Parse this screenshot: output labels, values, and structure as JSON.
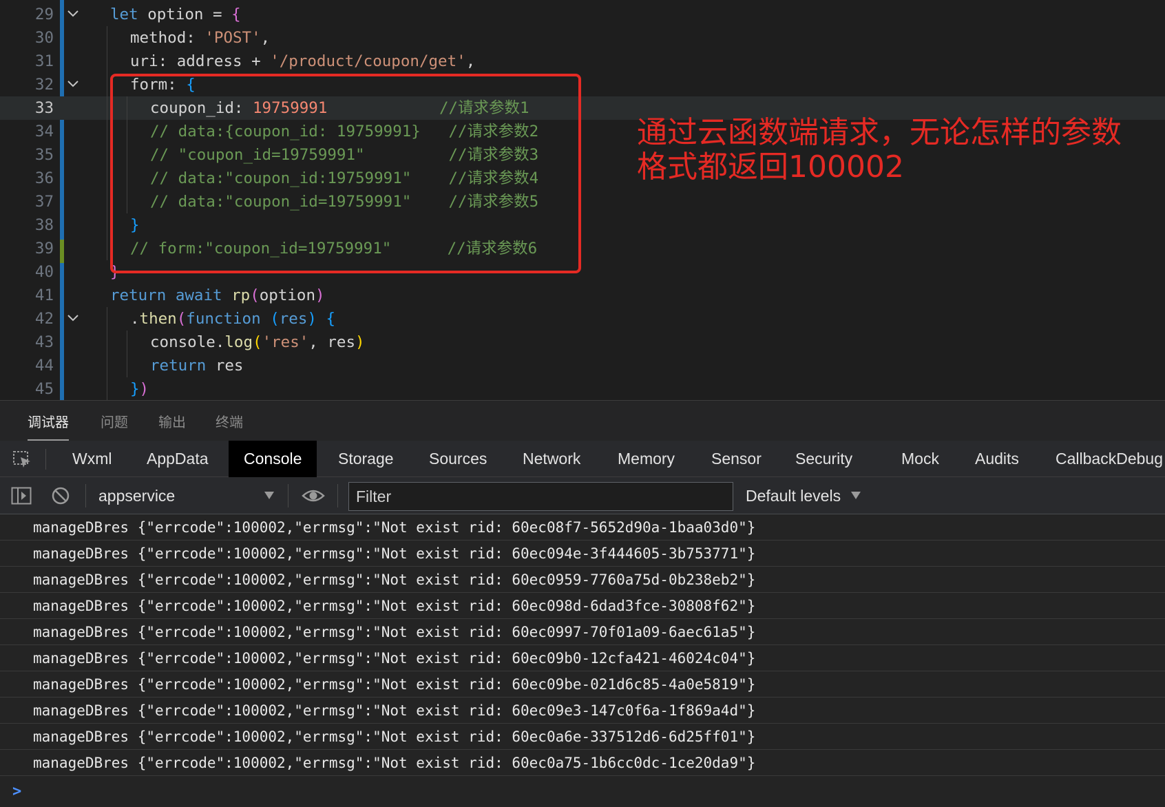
{
  "editor": {
    "lines": [
      {
        "n": "29",
        "indent": 0,
        "tokens": [
          [
            "kw",
            "let "
          ],
          [
            "var",
            "option "
          ],
          [
            "var",
            "= "
          ],
          [
            "brace",
            "{"
          ]
        ],
        "fold": true
      },
      {
        "n": "30",
        "indent": 1,
        "tokens": [
          [
            "prop",
            "method: "
          ],
          [
            "str",
            "'POST'"
          ],
          [
            "var",
            ","
          ]
        ]
      },
      {
        "n": "31",
        "indent": 1,
        "tokens": [
          [
            "prop",
            "uri: "
          ],
          [
            "var",
            "address + "
          ],
          [
            "str",
            "'/product/coupon/get'"
          ],
          [
            "var",
            ","
          ]
        ]
      },
      {
        "n": "32",
        "indent": 1,
        "tokens": [
          [
            "prop",
            "form: "
          ],
          [
            "brace3",
            "{"
          ]
        ],
        "fold": true
      },
      {
        "n": "33",
        "indent": 2,
        "tokens": [
          [
            "prop",
            "coupon_id: "
          ],
          [
            "num",
            "19759991"
          ],
          [
            "var",
            "            "
          ],
          [
            "cmt",
            "//请求参数1"
          ]
        ],
        "current": true
      },
      {
        "n": "34",
        "indent": 2,
        "tokens": [
          [
            "cmt",
            "// data:{coupon_id: 19759991}   //请求参数2"
          ]
        ]
      },
      {
        "n": "35",
        "indent": 2,
        "tokens": [
          [
            "cmt",
            "// \"coupon_id=19759991\"         //请求参数3"
          ]
        ]
      },
      {
        "n": "36",
        "indent": 2,
        "tokens": [
          [
            "cmt",
            "// data:\"coupon_id:19759991\"    //请求参数4"
          ]
        ]
      },
      {
        "n": "37",
        "indent": 2,
        "tokens": [
          [
            "cmt",
            "// data:\"coupon_id=19759991\"    //请求参数5"
          ]
        ]
      },
      {
        "n": "38",
        "indent": 1,
        "tokens": [
          [
            "brace3",
            "}"
          ]
        ]
      },
      {
        "n": "39",
        "indent": 1,
        "tokens": [
          [
            "cmt",
            "// form:\"coupon_id=19759991\"      //请求参数6"
          ]
        ]
      },
      {
        "n": "40",
        "indent": 0,
        "tokens": [
          [
            "brace",
            "}"
          ]
        ]
      },
      {
        "n": "41",
        "indent": 0,
        "tokens": [
          [
            "kw",
            "return "
          ],
          [
            "kw",
            "await "
          ],
          [
            "fn",
            "rp"
          ],
          [
            "brace",
            "("
          ],
          [
            "var",
            "option"
          ],
          [
            "brace",
            ")"
          ]
        ]
      },
      {
        "n": "42",
        "indent": 1,
        "tokens": [
          [
            "var",
            "."
          ],
          [
            "fn",
            "then"
          ],
          [
            "brace",
            "("
          ],
          [
            "kw",
            "function "
          ],
          [
            "brace3",
            "("
          ],
          [
            "kw",
            "res"
          ],
          [
            "brace3",
            ")"
          ],
          [
            "var",
            " "
          ],
          [
            "brace3",
            "{"
          ]
        ],
        "fold": true
      },
      {
        "n": "43",
        "indent": 2,
        "tokens": [
          [
            "var",
            "console."
          ],
          [
            "fn",
            "log"
          ],
          [
            "brace2",
            "("
          ],
          [
            "str",
            "'res'"
          ],
          [
            "var",
            ", res"
          ],
          [
            "brace2",
            ")"
          ]
        ]
      },
      {
        "n": "44",
        "indent": 2,
        "tokens": [
          [
            "kw",
            "return "
          ],
          [
            "var",
            "res"
          ]
        ]
      },
      {
        "n": "45",
        "indent": 1,
        "tokens": [
          [
            "brace3",
            "}"
          ],
          [
            "brace",
            ")"
          ]
        ]
      }
    ]
  },
  "annotation": {
    "line1": "通过云函数端请求，无论怎样的参数",
    "line2": "格式都返回100002",
    "color": "#e52a24"
  },
  "panel_tabs": [
    "调试器",
    "问题",
    "输出",
    "终端"
  ],
  "devtools_tabs": [
    "Wxml",
    "AppData",
    "Console",
    "Storage",
    "Sources",
    "Network",
    "Memory",
    "Sensor",
    "Security",
    "Mock",
    "Audits",
    "CallbackDebug"
  ],
  "devtools_active_tab": "Console",
  "console_toolbar": {
    "context": "appservice",
    "filter_placeholder": "Filter",
    "levels": "Default levels"
  },
  "console_logs": [
    "manageDBres {\"errcode\":100002,\"errmsg\":\"Not exist rid: 60ec08f7-5652d90a-1baa03d0\"}",
    "manageDBres {\"errcode\":100002,\"errmsg\":\"Not exist rid: 60ec094e-3f444605-3b753771\"}",
    "manageDBres {\"errcode\":100002,\"errmsg\":\"Not exist rid: 60ec0959-7760a75d-0b238eb2\"}",
    "manageDBres {\"errcode\":100002,\"errmsg\":\"Not exist rid: 60ec098d-6dad3fce-30808f62\"}",
    "manageDBres {\"errcode\":100002,\"errmsg\":\"Not exist rid: 60ec0997-70f01a09-6aec61a5\"}",
    "manageDBres {\"errcode\":100002,\"errmsg\":\"Not exist rid: 60ec09b0-12cfa421-46024c04\"}",
    "manageDBres {\"errcode\":100002,\"errmsg\":\"Not exist rid: 60ec09be-021d6c85-4a0e5819\"}",
    "manageDBres {\"errcode\":100002,\"errmsg\":\"Not exist rid: 60ec09e3-147c0f6a-1f869a4d\"}",
    "manageDBres {\"errcode\":100002,\"errmsg\":\"Not exist rid: 60ec0a6e-337512d6-6d25ff01\"}",
    "manageDBres {\"errcode\":100002,\"errmsg\":\"Not exist rid: 60ec0a75-1b6cc0dc-1ce20da9\"}"
  ],
  "console_prompt": ">"
}
